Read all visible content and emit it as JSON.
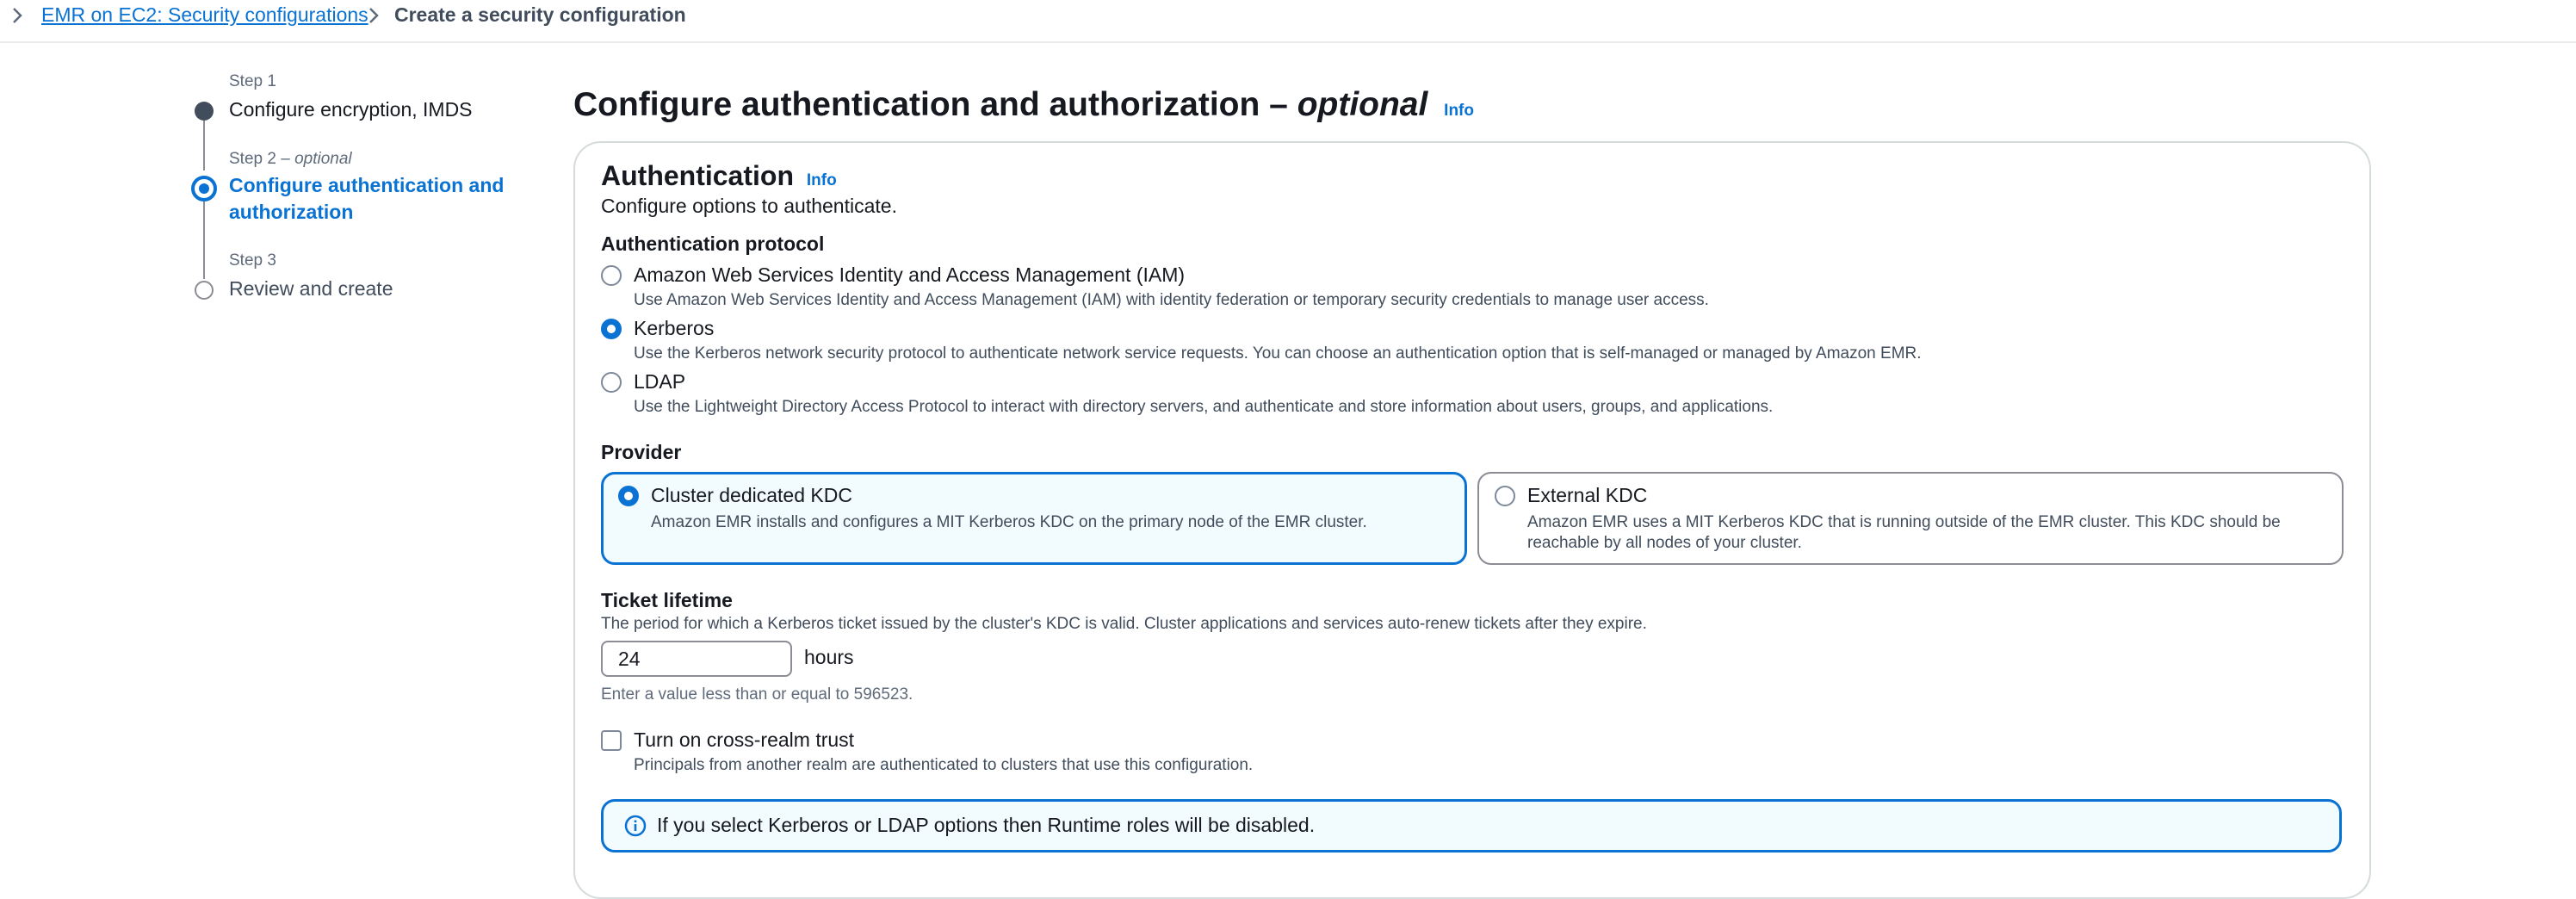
{
  "breadcrumb": {
    "parent": "EMR on EC2: Security configurations",
    "current": "Create a security configuration"
  },
  "steps": [
    {
      "label": "Step 1",
      "title": "Configure encryption, IMDS",
      "state": "completed"
    },
    {
      "label": "Step 2",
      "optional": "optional",
      "title": "Configure authentication and authorization",
      "state": "active"
    },
    {
      "label": "Step 3",
      "title": "Review and create",
      "state": "pending"
    }
  ],
  "page": {
    "title": "Configure authentication and authorization –",
    "title_optional": "optional",
    "info": "Info"
  },
  "auth": {
    "title": "Authentication",
    "info": "Info",
    "description": "Configure options to authenticate.",
    "protocol_label": "Authentication protocol",
    "protocols": [
      {
        "label": "Amazon Web Services Identity and Access Management (IAM)",
        "description": "Use Amazon Web Services Identity and Access Management (IAM) with identity federation or temporary security credentials to manage user access.",
        "selected": false
      },
      {
        "label": "Kerberos",
        "description": "Use the Kerberos network security protocol to authenticate network service requests. You can choose an authentication option that is self-managed or managed by Amazon EMR.",
        "selected": true
      },
      {
        "label": "LDAP",
        "description": "Use the Lightweight Directory Access Protocol to interact with directory servers, and authenticate and store information about users, groups, and applications.",
        "selected": false
      }
    ],
    "provider_label": "Provider",
    "providers": [
      {
        "label": "Cluster dedicated KDC",
        "description": "Amazon EMR installs and configures a MIT Kerberos KDC on the primary node of the EMR cluster.",
        "selected": true
      },
      {
        "label": "External KDC",
        "description_line1": "Amazon EMR uses a MIT Kerberos KDC that is running outside of the EMR cluster. This KDC should be",
        "description_line2": "reachable by all nodes of your cluster.",
        "selected": false
      }
    ],
    "ticket": {
      "label": "Ticket lifetime",
      "description": "The period for which a Kerberos ticket issued by the cluster's KDC is valid. Cluster applications and services auto-renew tickets after they expire.",
      "value": "24",
      "unit": "hours",
      "constraint": "Enter a value less than or equal to 596523."
    },
    "cross_realm": {
      "label": "Turn on cross-realm trust",
      "description": "Principals from another realm are authenticated to clusters that use this configuration.",
      "checked": false
    },
    "alert": "If you select Kerberos or LDAP options then Runtime roles will be disabled."
  },
  "colors": {
    "accent": "#0972d3",
    "text": "#16191f",
    "secondary_text": "#414d5c",
    "selected_tile_bg": "#f2fbfd",
    "border": "#8c8c94"
  }
}
